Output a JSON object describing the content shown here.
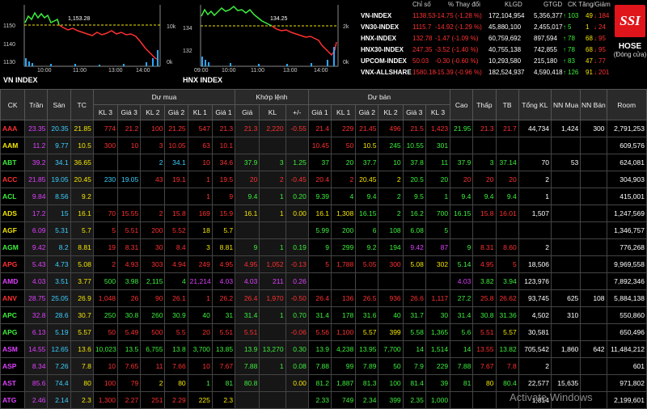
{
  "charts": [
    {
      "title": "VN INDEX",
      "y_left": [
        "1150",
        "1140",
        "1130"
      ],
      "y_right": [
        "10k",
        "0k"
      ],
      "x_ticks": [
        "10:00",
        "11:00",
        "13:00",
        "14:00"
      ],
      "ref_value": "1,153.28"
    },
    {
      "title": "HNX INDEX",
      "y_left": [
        "134",
        "132"
      ],
      "y_right": [
        "2k",
        "0k"
      ],
      "x_ticks": [
        "09:00",
        "10:00",
        "11:00",
        "13:00",
        "14:00"
      ],
      "ref_value": "134.25"
    }
  ],
  "index_header": [
    "Chỉ số",
    "% Thay đổi",
    "KLGD",
    "GTGD",
    "CK Tăng/Giảm"
  ],
  "indices": [
    {
      "name": "VN-INDEX",
      "value": "1138.53",
      "change": "-14.75 (-1.28 %)",
      "vol": "172,104,954",
      "val": "5,356,377",
      "up": "103",
      "ref": "49",
      "down": "184"
    },
    {
      "name": "VN30-INDEX",
      "value": "1115.7",
      "change": "-14.92 (-1.29 %)",
      "vol": "45,880,100",
      "val": "2,455,017",
      "up": "5",
      "ref": "1",
      "down": "24"
    },
    {
      "name": "HNX-INDEX",
      "value": "132.78",
      "change": "-1.47 (-1.09 %)",
      "vol": "60,759,692",
      "val": "897,594",
      "up": "78",
      "ref": "68",
      "down": "95"
    },
    {
      "name": "HNX30-INDEX",
      "value": "247.35",
      "change": "-3.52 (-1.40 %)",
      "vol": "40,755,138",
      "val": "742,855",
      "up": "78",
      "ref": "68",
      "down": "95"
    },
    {
      "name": "UPCOM-INDEX",
      "value": "50.03",
      "change": "-0.30 (-0.60 %)",
      "vol": "10,293,580",
      "val": "215,180",
      "up": "83",
      "ref": "47",
      "down": "77"
    },
    {
      "name": "VNX-ALLSHARE",
      "value": "1580.18",
      "change": "-15.39 (-0.96 %)",
      "vol": "182,524,937",
      "val": "4,590,418",
      "up": "126",
      "ref": "91",
      "down": "201"
    }
  ],
  "brand": {
    "logo": "SSI",
    "exchange": "HOSE",
    "session": "(Đóng cửa)"
  },
  "groups": {
    "buy": "Dư mua",
    "match": "Khớp lệnh",
    "sell": "Dư bán"
  },
  "columns": [
    "CK",
    "Trần",
    "Sàn",
    "TC",
    "KL 3",
    "Giá 3",
    "KL 2",
    "Giá 2",
    "KL 1",
    "Giá 1",
    "Giá",
    "KL",
    "+/-",
    "Giá 1",
    "KL 1",
    "Giá 2",
    "KL 2",
    "Giá 3",
    "KL 3",
    "Cao",
    "Thấp",
    "TB",
    "Tổng KL",
    "NN Mua",
    "NN Bán",
    "Room"
  ],
  "rows": [
    {
      "c": [
        "AAA",
        "23.35",
        "20.35",
        "21.85",
        "774",
        "21.2",
        "100",
        "21.25",
        "547",
        "21.3",
        "21.3",
        "2,220",
        "-0.55",
        "21.4",
        "229",
        "21.45",
        "496",
        "21.5",
        "1,423",
        "21.95",
        "21.3",
        "21.7",
        "44,734",
        "1,424",
        "300",
        "2,791,253"
      ],
      "k": [
        "dn",
        "ceil",
        "floor",
        "ref-c",
        "dn",
        "dn",
        "dn",
        "dn",
        "dn",
        "dn",
        "dn",
        "dn",
        "dn",
        "dn",
        "dn",
        "dn",
        "dn",
        "dn",
        "dn",
        "up",
        "dn",
        "dn",
        "wht",
        "wht",
        "wht",
        "wht"
      ]
    },
    {
      "c": [
        "AAM",
        "11.2",
        "9.77",
        "10.5",
        "300",
        "10",
        "3",
        "10.05",
        "63",
        "10.1",
        "",
        "",
        "",
        "10.45",
        "50",
        "10.5",
        "245",
        "10.55",
        "301",
        "",
        "",
        "",
        "",
        "",
        "",
        "609,576"
      ],
      "k": [
        "ref-c",
        "ceil",
        "floor",
        "ref-c",
        "dn",
        "dn",
        "dn",
        "dn",
        "dn",
        "dn",
        "",
        "",
        "",
        "dn",
        "dn",
        "ref-c",
        "up",
        "up",
        "up",
        "",
        "",
        "",
        "",
        "",
        "",
        "wht"
      ]
    },
    {
      "c": [
        "ABT",
        "39.2",
        "34.1",
        "36.65",
        "",
        "",
        "2",
        "34.1",
        "10",
        "34.6",
        "37.9",
        "3",
        "1.25",
        "37",
        "20",
        "37.7",
        "10",
        "37.8",
        "11",
        "37.9",
        "3",
        "37.14",
        "70",
        "53",
        "",
        "624,081"
      ],
      "k": [
        "up",
        "ceil",
        "floor",
        "ref-c",
        "",
        "",
        "floor",
        "floor",
        "dn",
        "dn",
        "up",
        "up",
        "up",
        "up",
        "up",
        "up",
        "up",
        "up",
        "up",
        "up",
        "up",
        "up",
        "wht",
        "wht",
        "",
        "wht"
      ]
    },
    {
      "c": [
        "ACC",
        "21.85",
        "19.05",
        "20.45",
        "230",
        "19.05",
        "43",
        "19.1",
        "1",
        "19.5",
        "20",
        "2",
        "-0.45",
        "20.4",
        "2",
        "20.45",
        "2",
        "20.5",
        "20",
        "20",
        "20",
        "20",
        "2",
        "",
        "",
        "304,903"
      ],
      "k": [
        "dn",
        "ceil",
        "floor",
        "ref-c",
        "floor",
        "floor",
        "dn",
        "dn",
        "dn",
        "dn",
        "dn",
        "dn",
        "dn",
        "dn",
        "dn",
        "ref-c",
        "ref-c",
        "up",
        "up",
        "dn",
        "dn",
        "dn",
        "wht",
        "",
        "",
        "wht"
      ]
    },
    {
      "c": [
        "ACL",
        "9.84",
        "8.56",
        "9.2",
        "",
        "",
        "",
        "",
        "1",
        "9",
        "9.4",
        "1",
        "0.20",
        "9.39",
        "4",
        "9.4",
        "2",
        "9.5",
        "1",
        "9.4",
        "9.4",
        "9.4",
        "1",
        "",
        "",
        "415,001"
      ],
      "k": [
        "up",
        "ceil",
        "floor",
        "ref-c",
        "",
        "",
        "",
        "",
        "dn",
        "dn",
        "up",
        "up",
        "up",
        "up",
        "up",
        "up",
        "up",
        "up",
        "up",
        "up",
        "up",
        "up",
        "wht",
        "",
        "",
        "wht"
      ]
    },
    {
      "c": [
        "ADS",
        "17.2",
        "15",
        "16.1",
        "70",
        "15.55",
        "2",
        "15.8",
        "169",
        "15.9",
        "16.1",
        "1",
        "0.00",
        "16.1",
        "1,308",
        "16.15",
        "2",
        "16.2",
        "700",
        "16.15",
        "15.8",
        "16.01",
        "1,507",
        "",
        "",
        "1,247,569"
      ],
      "k": [
        "ref-c",
        "ceil",
        "floor",
        "ref-c",
        "dn",
        "dn",
        "dn",
        "dn",
        "dn",
        "dn",
        "ref-c",
        "ref-c",
        "ref-c",
        "ref-c",
        "ref-c",
        "up",
        "up",
        "up",
        "up",
        "up",
        "dn",
        "dn",
        "wht",
        "",
        "",
        "wht"
      ]
    },
    {
      "c": [
        "AGF",
        "6.09",
        "5.31",
        "5.7",
        "5",
        "5.51",
        "200",
        "5.52",
        "18",
        "5.7",
        "",
        "",
        "",
        "5.99",
        "200",
        "6",
        "108",
        "6.08",
        "5",
        "",
        "",
        "",
        "",
        "",
        "",
        "1,346,757"
      ],
      "k": [
        "ref-c",
        "ceil",
        "floor",
        "ref-c",
        "dn",
        "dn",
        "dn",
        "dn",
        "ref-c",
        "ref-c",
        "",
        "",
        "",
        "up",
        "up",
        "up",
        "up",
        "up",
        "up",
        "",
        "",
        "",
        "",
        "",
        "",
        "wht"
      ]
    },
    {
      "c": [
        "AGM",
        "9.42",
        "8.2",
        "8.81",
        "19",
        "8.31",
        "30",
        "8.4",
        "3",
        "8.81",
        "9",
        "1",
        "0.19",
        "9",
        "299",
        "9.2",
        "194",
        "9.42",
        "87",
        "9",
        "8.31",
        "8.60",
        "2",
        "",
        "",
        "776,268"
      ],
      "k": [
        "up",
        "ceil",
        "floor",
        "ref-c",
        "dn",
        "dn",
        "dn",
        "dn",
        "ref-c",
        "ref-c",
        "up",
        "up",
        "up",
        "up",
        "up",
        "up",
        "up",
        "ceil",
        "ceil",
        "up",
        "dn",
        "dn",
        "wht",
        "",
        "",
        "wht"
      ]
    },
    {
      "c": [
        "APG",
        "5.43",
        "4.73",
        "5.08",
        "2",
        "4.93",
        "303",
        "4.94",
        "249",
        "4.95",
        "4.95",
        "1,052",
        "-0.13",
        "5",
        "1,788",
        "5.05",
        "300",
        "5.08",
        "302",
        "5.14",
        "4.95",
        "5",
        "18,506",
        "",
        "",
        "9,969,558"
      ],
      "k": [
        "dn",
        "ceil",
        "floor",
        "ref-c",
        "dn",
        "dn",
        "dn",
        "dn",
        "dn",
        "dn",
        "dn",
        "dn",
        "dn",
        "dn",
        "dn",
        "dn",
        "dn",
        "ref-c",
        "ref-c",
        "up",
        "dn",
        "dn",
        "wht",
        "",
        "",
        "wht"
      ]
    },
    {
      "c": [
        "AMD",
        "4.03",
        "3.51",
        "3.77",
        "500",
        "3.98",
        "2,115",
        "4",
        "21,214",
        "4.03",
        "4.03",
        "211",
        "0.26",
        "",
        "",
        "",
        "",
        "",
        "",
        "4.03",
        "3.82",
        "3.94",
        "123,976",
        "",
        "",
        "7,892,346"
      ],
      "k": [
        "ceil",
        "ceil",
        "floor",
        "ref-c",
        "up",
        "up",
        "up",
        "up",
        "ceil",
        "ceil",
        "ceil",
        "ceil",
        "ceil",
        "",
        "",
        "",
        "",
        "",
        "",
        "ceil",
        "up",
        "up",
        "wht",
        "",
        "",
        "wht"
      ]
    },
    {
      "c": [
        "ANV",
        "28.75",
        "25.05",
        "26.9",
        "1,048",
        "26",
        "90",
        "26.1",
        "1",
        "26.2",
        "26.4",
        "1,970",
        "-0.50",
        "26.4",
        "136",
        "26.5",
        "936",
        "26.6",
        "1,117",
        "27.2",
        "25.8",
        "26.62",
        "93,745",
        "625",
        "108",
        "5,884,138"
      ],
      "k": [
        "dn",
        "ceil",
        "floor",
        "ref-c",
        "dn",
        "dn",
        "dn",
        "dn",
        "dn",
        "dn",
        "dn",
        "dn",
        "dn",
        "dn",
        "dn",
        "dn",
        "dn",
        "dn",
        "dn",
        "up",
        "dn",
        "dn",
        "wht",
        "wht",
        "wht",
        "wht"
      ]
    },
    {
      "c": [
        "APC",
        "32.8",
        "28.6",
        "30.7",
        "250",
        "30.8",
        "260",
        "30.9",
        "40",
        "31",
        "31.4",
        "1",
        "0.70",
        "31.4",
        "178",
        "31.6",
        "40",
        "31.7",
        "30",
        "31.4",
        "30.8",
        "31.36",
        "4,502",
        "310",
        "",
        "550,860"
      ],
      "k": [
        "up",
        "ceil",
        "floor",
        "ref-c",
        "up",
        "up",
        "up",
        "up",
        "up",
        "up",
        "up",
        "up",
        "up",
        "up",
        "up",
        "up",
        "up",
        "up",
        "up",
        "up",
        "up",
        "up",
        "wht",
        "wht",
        "",
        "wht"
      ]
    },
    {
      "c": [
        "APG",
        "6.13",
        "5.19",
        "5.57",
        "50",
        "5.49",
        "500",
        "5.5",
        "20",
        "5.51",
        "5.51",
        "",
        "-0.06",
        "5.56",
        "1,100",
        "5.57",
        "399",
        "5.58",
        "1,365",
        "5.6",
        "5.51",
        "5.57",
        "30,581",
        "",
        "",
        "650,496"
      ],
      "k": [
        "up",
        "ceil",
        "floor",
        "ref-c",
        "dn",
        "dn",
        "dn",
        "dn",
        "dn",
        "dn",
        "dn",
        "dn",
        "dn",
        "dn",
        "dn",
        "ref-c",
        "ref-c",
        "up",
        "up",
        "up",
        "dn",
        "ref-c",
        "wht",
        "",
        "",
        "wht"
      ]
    },
    {
      "c": [
        "ASM",
        "14.55",
        "12.65",
        "13.6",
        "10,023",
        "13.5",
        "6,755",
        "13.8",
        "3,700",
        "13.85",
        "13.9",
        "13,270",
        "0.30",
        "13.9",
        "4,238",
        "13.95",
        "7,700",
        "14",
        "1,514",
        "14",
        "13.55",
        "13.82",
        "705,542",
        "1,860",
        "642",
        "11,484,212"
      ],
      "k": [
        "ceil",
        "ceil",
        "floor",
        "ref-c",
        "up",
        "up",
        "up",
        "up",
        "up",
        "up",
        "up",
        "up",
        "up",
        "up",
        "up",
        "up",
        "up",
        "up",
        "up",
        "up",
        "dn",
        "up",
        "wht",
        "wht",
        "wht",
        "wht"
      ]
    },
    {
      "c": [
        "ASP",
        "8.34",
        "7.26",
        "7.8",
        "10",
        "7.65",
        "11",
        "7.66",
        "10",
        "7.67",
        "7.88",
        "1",
        "0.08",
        "7.88",
        "99",
        "7.89",
        "50",
        "7.9",
        "229",
        "7.88",
        "7.67",
        "7.8",
        "2",
        "",
        "",
        "601"
      ],
      "k": [
        "ceil",
        "ceil",
        "floor",
        "ref-c",
        "dn",
        "dn",
        "dn",
        "dn",
        "dn",
        "dn",
        "up",
        "up",
        "up",
        "up",
        "up",
        "up",
        "up",
        "up",
        "up",
        "up",
        "dn",
        "dn",
        "wht",
        "",
        "",
        "wht"
      ]
    },
    {
      "c": [
        "AST",
        "85.6",
        "74.4",
        "80",
        "100",
        "79",
        "2",
        "80",
        "1",
        "81",
        "80.8",
        "",
        "0.00",
        "81.2",
        "1,887",
        "81.3",
        "100",
        "81.4",
        "39",
        "81",
        "80",
        "80.4",
        "22,577",
        "15,635",
        "",
        "971,802"
      ],
      "k": [
        "ceil",
        "ceil",
        "floor",
        "ref-c",
        "dn",
        "dn",
        "ref-c",
        "ref-c",
        "up",
        "up",
        "up",
        "up",
        "ref-c",
        "up",
        "up",
        "up",
        "up",
        "up",
        "up",
        "up",
        "ref-c",
        "up",
        "wht",
        "wht",
        "",
        "wht"
      ]
    },
    {
      "c": [
        "ATG",
        "2.46",
        "2.14",
        "2.3",
        "1,300",
        "2.27",
        "251",
        "2.29",
        "225",
        "2.3",
        "",
        "",
        "",
        "2.33",
        "749",
        "2.34",
        "399",
        "2.35",
        "1,000",
        "",
        "",
        "",
        "1,814",
        "",
        "",
        "2,199,601"
      ],
      "k": [
        "ceil",
        "ceil",
        "floor",
        "ref-c",
        "dn",
        "dn",
        "dn",
        "dn",
        "ref-c",
        "ref-c",
        "",
        "",
        "",
        "up",
        "up",
        "up",
        "up",
        "up",
        "up",
        "",
        "",
        "",
        "wht",
        "",
        "",
        "wht"
      ]
    }
  ],
  "watermark": "Activate Windows"
}
